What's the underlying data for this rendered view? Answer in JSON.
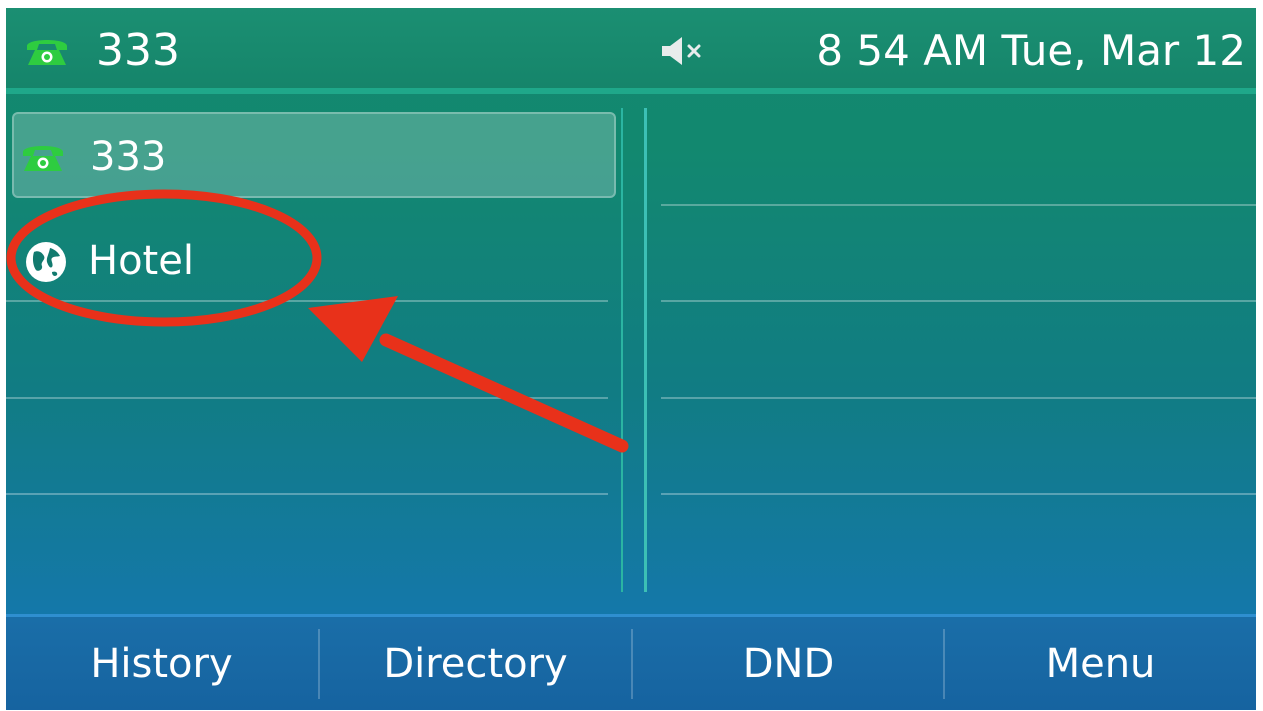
{
  "status_bar": {
    "account": "333",
    "clock": "8 54 AM Tue, Mar 12",
    "phone_icon": "phone-handset-icon",
    "mute_icon": "speaker-muted-icon"
  },
  "line_keys": [
    {
      "label": "333",
      "icon": "phone-handset-icon",
      "selected": true
    },
    {
      "label": "Hotel",
      "icon": "globe-icon",
      "selected": false
    }
  ],
  "softkeys": [
    {
      "label": "History"
    },
    {
      "label": "Directory"
    },
    {
      "label": "DND"
    },
    {
      "label": "Menu"
    }
  ],
  "colors": {
    "phone_icon": "#2ecc40",
    "annotation": "#e8311a",
    "screen_top": "#148970",
    "softkey_bar": "#1a6ea8"
  }
}
